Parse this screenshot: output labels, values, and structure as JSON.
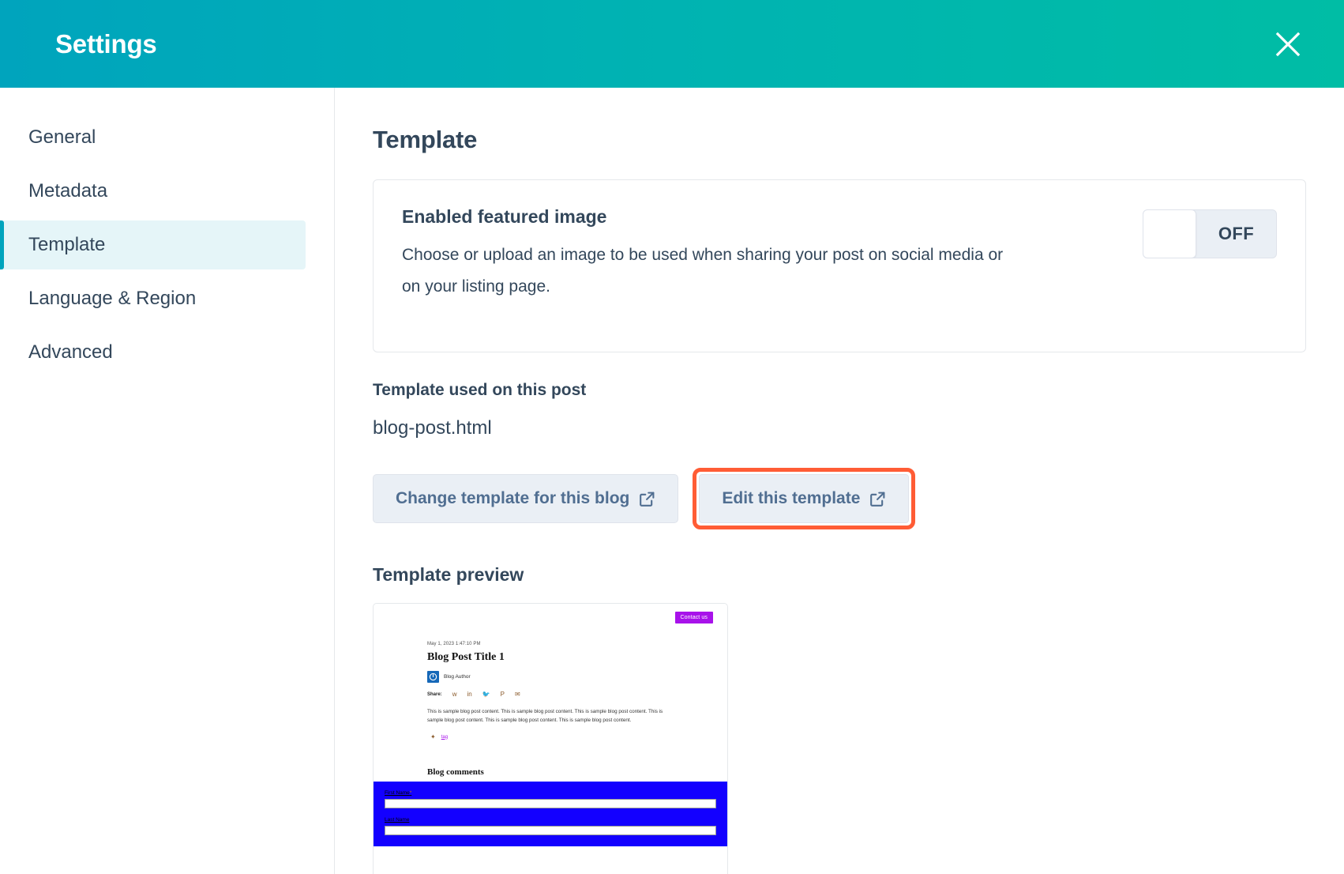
{
  "header": {
    "title": "Settings",
    "close_icon": "close-icon"
  },
  "sidebar": {
    "items": [
      {
        "label": "General",
        "active": false
      },
      {
        "label": "Metadata",
        "active": false
      },
      {
        "label": "Template",
        "active": true
      },
      {
        "label": "Language & Region",
        "active": false
      },
      {
        "label": "Advanced",
        "active": false
      }
    ],
    "active_accent": "#00a4bd",
    "active_background": "#e5f5f8"
  },
  "main": {
    "page_title": "Template",
    "featured_image": {
      "heading": "Enabled featured image",
      "description": "Choose or upload an image to be used when sharing your post on social media or on your listing page.",
      "toggle_state": "OFF"
    },
    "template_used": {
      "heading": "Template used on this post",
      "value": "blog-post.html"
    },
    "buttons": {
      "change_template": "Change template for this blog",
      "edit_template": "Edit this template",
      "external_link_icon": "external-link-icon",
      "highlight_color": "#ff5c35"
    },
    "preview": {
      "heading": "Template preview",
      "contact_button": "Contact us",
      "date": "May 1, 2023 1:47:10 PM",
      "post_title": "Blog Post Title 1",
      "author": "Blog Author",
      "share_label": "Share:",
      "share_icons": [
        "facebook-icon",
        "linkedin-icon",
        "twitter-icon",
        "pinterest-icon",
        "email-icon"
      ],
      "body_text": "This is sample blog post content. This is sample blog post content. This is sample blog post content. This is sample blog post content. This is sample blog post content. This is sample blog post content.",
      "tag": "tag",
      "comments_heading": "Blog comments",
      "form": {
        "first_name_label": "First Name",
        "first_name_required": "*",
        "last_name_label": "Last Name",
        "background_color": "#1300ff"
      }
    }
  }
}
